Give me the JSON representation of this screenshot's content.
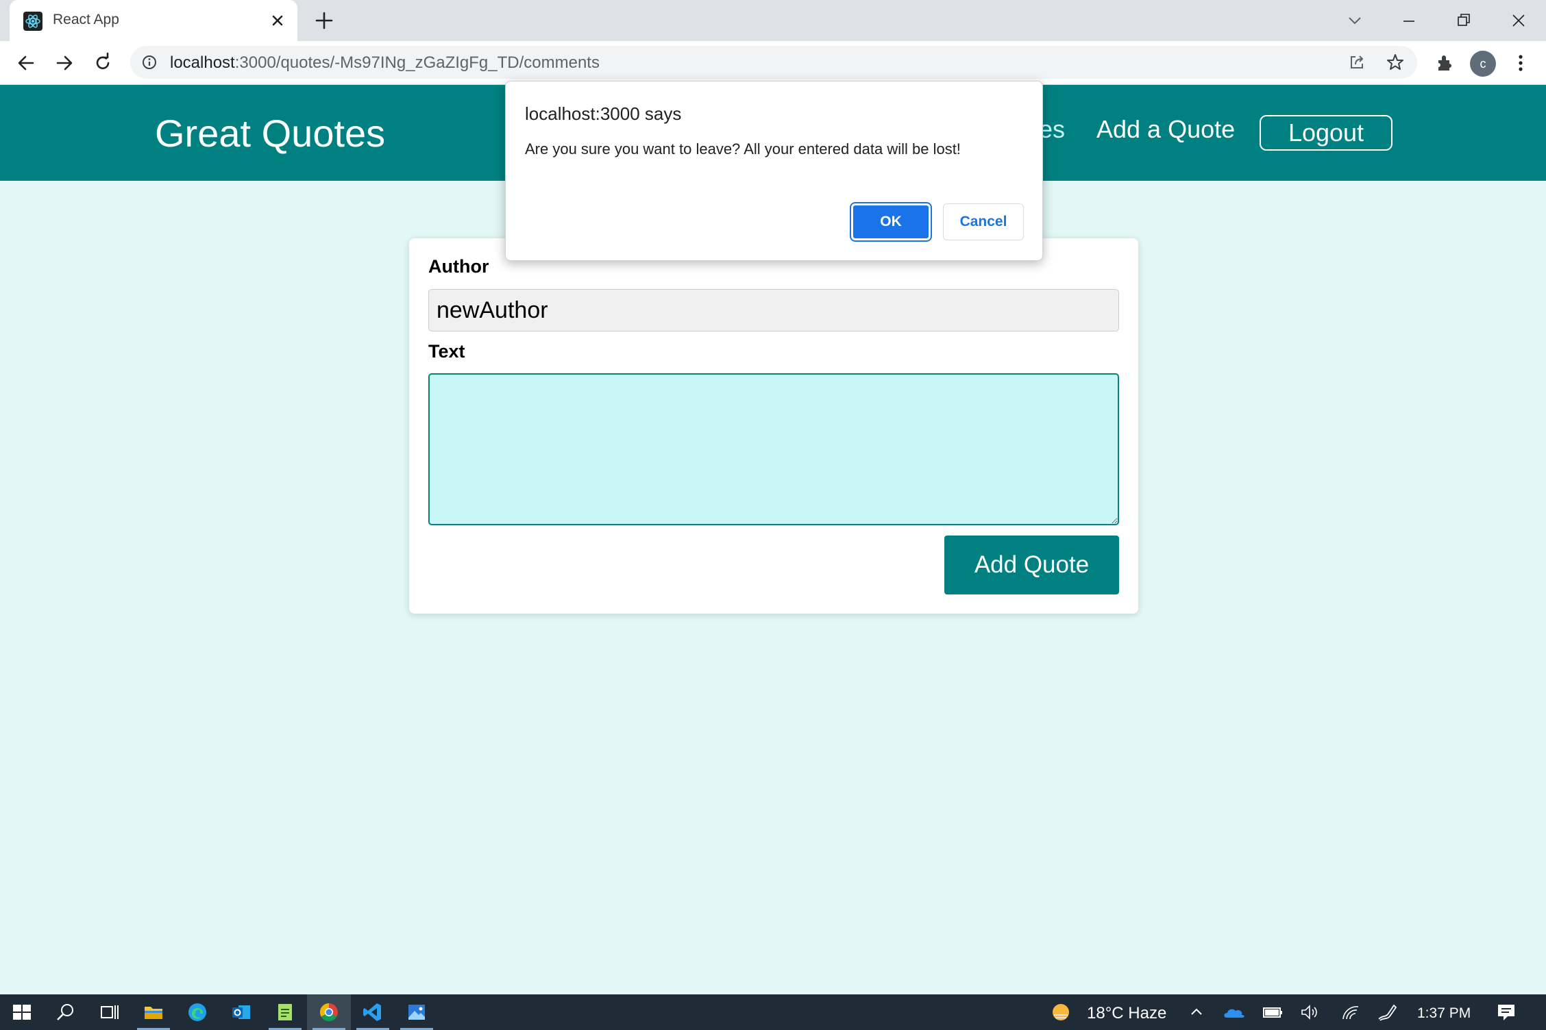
{
  "browser": {
    "tab_title": "React App",
    "url_host": "localhost",
    "url_rest": ":3000/quotes/-Ms97INg_zGaZIgFg_TD/comments",
    "profile_initial": "c"
  },
  "header": {
    "logo": "Great Quotes",
    "nav_all_quotes_partial": "es",
    "nav_add_quote": "Add a Quote",
    "logout": "Logout"
  },
  "form": {
    "author_label": "Author",
    "author_value": "newAuthor",
    "text_label": "Text",
    "text_value": "",
    "submit_label": "Add Quote"
  },
  "dialog": {
    "title": "localhost:3000 says",
    "message": "Are you sure you want to leave? All your entered data will be lost!",
    "ok": "OK",
    "cancel": "Cancel"
  },
  "taskbar": {
    "weather": "18°C  Haze",
    "time": "1:37 PM"
  },
  "colors": {
    "brand": "#008080",
    "page_bg": "#e3f7f6",
    "textarea_bg": "#c9f6f6",
    "dialog_accent": "#1a73e8"
  }
}
